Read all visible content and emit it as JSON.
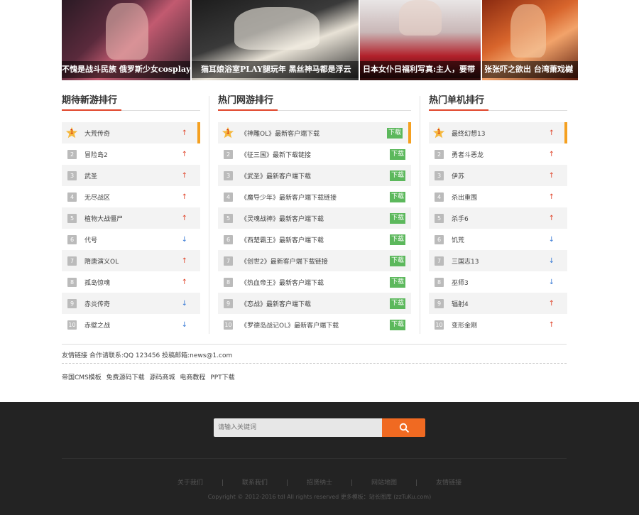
{
  "hero": [
    {
      "caption": "不愧是战斗民族 俄罗斯少女cosplay"
    },
    {
      "caption": "猫耳娘浴室PLAY腿玩年 黑丝神马都是浮云"
    },
    {
      "caption": "日本女仆日福利写真:主人，要带"
    },
    {
      "caption": "张张吓之欲出 台湾萧戏樾"
    }
  ],
  "columns": [
    {
      "title": "期待新游排行",
      "items": [
        {
          "rank": "1",
          "name": "大荒传奇",
          "trend": "up"
        },
        {
          "rank": "2",
          "name": "冒险岛2",
          "trend": "up"
        },
        {
          "rank": "3",
          "name": "武圣",
          "trend": "up"
        },
        {
          "rank": "4",
          "name": "无尽战区",
          "trend": "up"
        },
        {
          "rank": "5",
          "name": "植物大战僵尸",
          "trend": "up"
        },
        {
          "rank": "6",
          "name": "代号",
          "trend": "down"
        },
        {
          "rank": "7",
          "name": "隋唐演义OL",
          "trend": "up"
        },
        {
          "rank": "8",
          "name": "孤岛惊魂",
          "trend": "up"
        },
        {
          "rank": "9",
          "name": "赤炎传奇",
          "trend": "down"
        },
        {
          "rank": "10",
          "name": "赤壁之战",
          "trend": "down"
        }
      ]
    },
    {
      "title": "热门网游排行",
      "download_label": "下载",
      "items": [
        {
          "rank": "1",
          "name": "《神雕OL》最新客户端下载"
        },
        {
          "rank": "2",
          "name": "《征三国》最新下载链接"
        },
        {
          "rank": "3",
          "name": "《武圣》最新客户端下载"
        },
        {
          "rank": "4",
          "name": "《魔导少年》最新客户端下载链接"
        },
        {
          "rank": "5",
          "name": "《灵魂战神》最新客户端下载"
        },
        {
          "rank": "6",
          "name": "《西楚霸王》最新客户端下载"
        },
        {
          "rank": "7",
          "name": "《创世2》最新客户端下载链接"
        },
        {
          "rank": "8",
          "name": "《热血帝王》最新客户端下载"
        },
        {
          "rank": "9",
          "name": "《恋战》最新客户端下载"
        },
        {
          "rank": "10",
          "name": "《罗德岛战记OL》最新客户端下载"
        }
      ]
    },
    {
      "title": "热门单机排行",
      "items": [
        {
          "rank": "1",
          "name": "最终幻想13",
          "trend": "up"
        },
        {
          "rank": "2",
          "name": "勇者斗恶龙",
          "trend": "up"
        },
        {
          "rank": "3",
          "name": "伊苏",
          "trend": "up"
        },
        {
          "rank": "4",
          "name": "杀出重围",
          "trend": "up"
        },
        {
          "rank": "5",
          "name": "杀手6",
          "trend": "up"
        },
        {
          "rank": "6",
          "name": "饥荒",
          "trend": "down"
        },
        {
          "rank": "7",
          "name": "三国志13",
          "trend": "down"
        },
        {
          "rank": "8",
          "name": "巫师3",
          "trend": "down"
        },
        {
          "rank": "9",
          "name": "辐射4",
          "trend": "up"
        },
        {
          "rank": "10",
          "name": "变形金刚",
          "trend": "up"
        }
      ]
    }
  ],
  "links": {
    "header": "友情链接 合作请联系:QQ 123456 投稿邮箱:news@1.com",
    "items": [
      "帝国CMS模板",
      "免费源码下载",
      "源码商城",
      "电商教程",
      "PPT下载"
    ]
  },
  "footer": {
    "search_placeholder": "请输入关键词",
    "search_icon": "search-icon",
    "nav": [
      "关于我们",
      "联系我们",
      "招贤纳士",
      "网站地图",
      "友情链接"
    ],
    "copyright": "Copyright © 2012-2016 tdl  All rights reserved  更多模板：站长图库 (zzTuKu.com)"
  },
  "colors": {
    "accent": "#e0452b",
    "highlight": "#f5a020",
    "download": "#5cb85c",
    "footer_bg": "#232323",
    "search_button": "#f06a22"
  }
}
